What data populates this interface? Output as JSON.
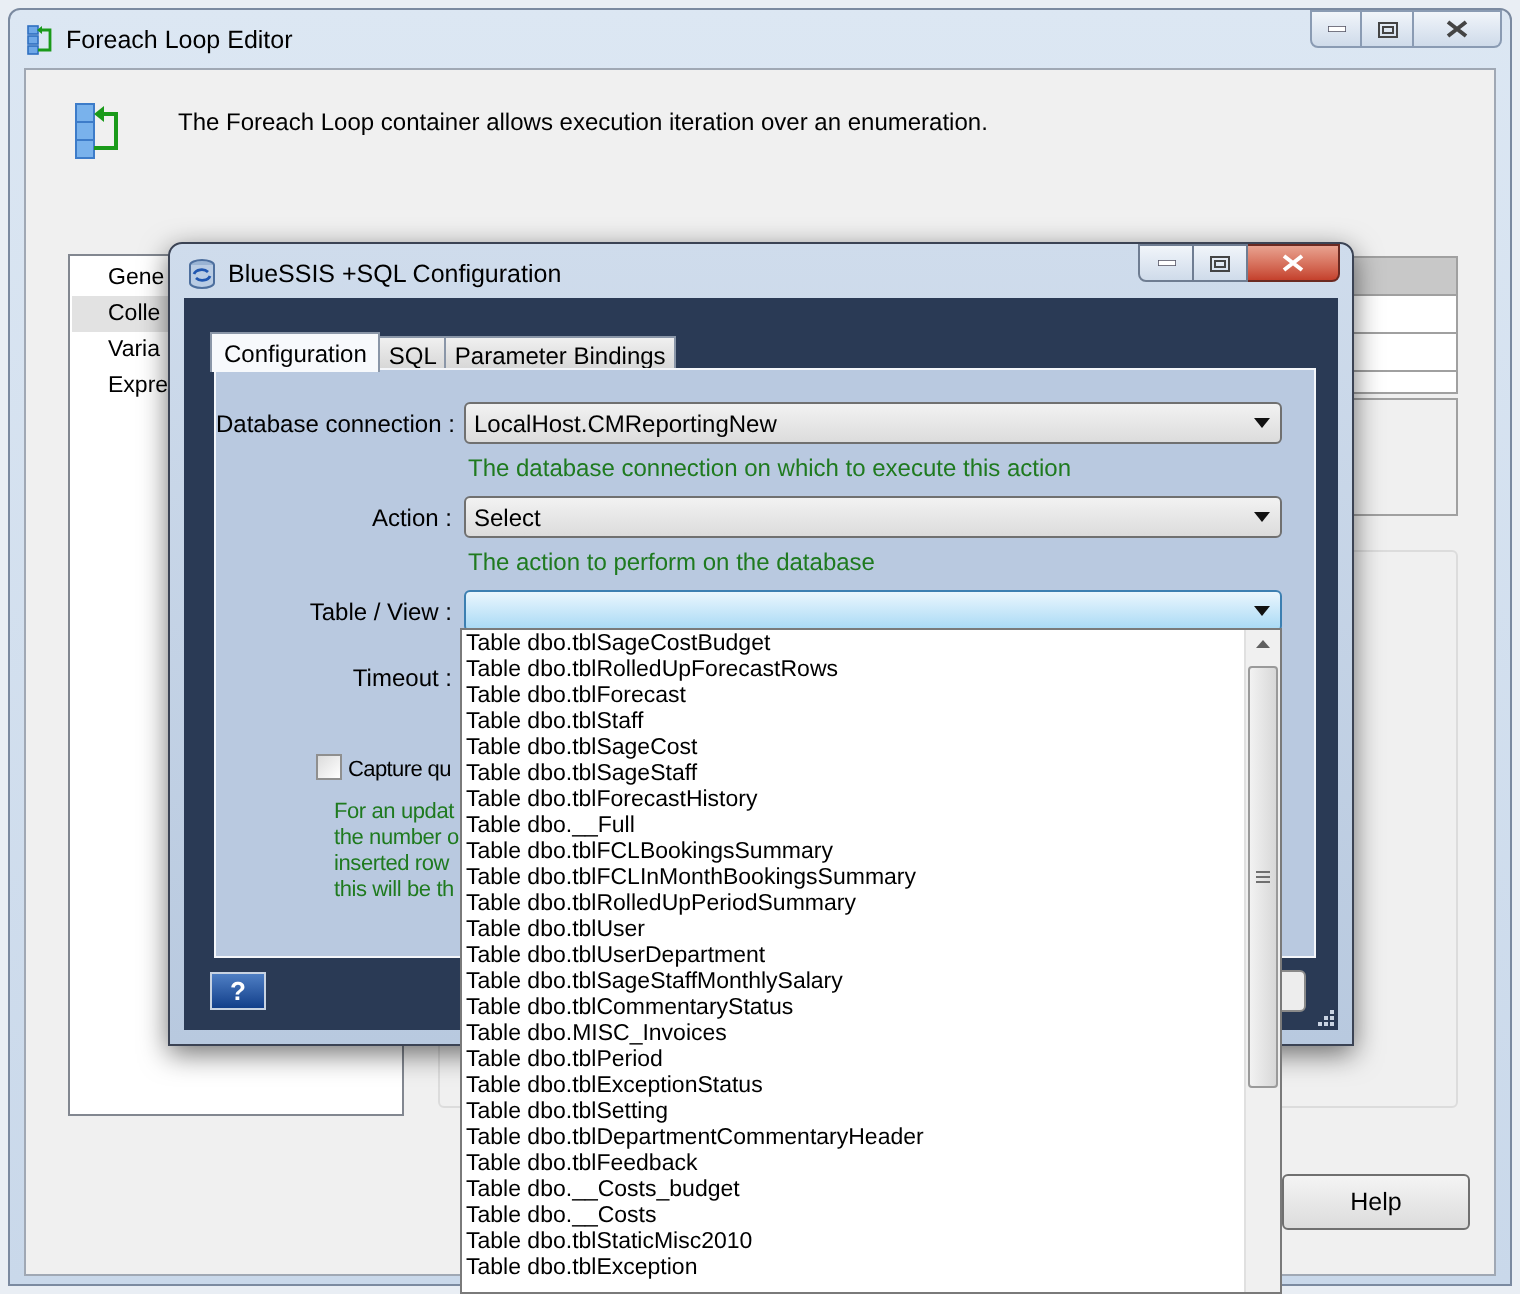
{
  "editor_window": {
    "title": "Foreach Loop Editor",
    "description": "The Foreach Loop container allows execution iteration over an enumeration.",
    "nav_items": [
      {
        "label": "Gene",
        "selected": false
      },
      {
        "label": "Colle",
        "selected": true
      },
      {
        "label": "Varia",
        "selected": false
      },
      {
        "label": "Expre",
        "selected": false
      }
    ],
    "help_button": "Help"
  },
  "config_dialog": {
    "title": "BlueSSIS +SQL Configuration",
    "tabs": [
      {
        "label": "Configuration",
        "selected": true
      },
      {
        "label": "SQL",
        "selected": false
      },
      {
        "label": "Parameter Bindings",
        "selected": false
      }
    ],
    "fields": [
      {
        "label": "Database connection :",
        "value": "LocalHost.CMReportingNew",
        "hint": "The database connection on which to execute this action",
        "focused": false
      },
      {
        "label": "Action :",
        "value": "Select",
        "hint": "The action to perform on the database",
        "focused": false
      },
      {
        "label": "Table / View :",
        "focused": true
      }
    ],
    "timeout_label": "Timeout :",
    "capture_checkbox": {
      "label": "Capture qu",
      "checked": false
    },
    "note_lines": [
      "For an updat",
      "the number o",
      "inserted row",
      "this will be th"
    ],
    "help_button": "?"
  },
  "dropdown": {
    "items": [
      "Table dbo.tblSageCostBudget",
      "Table dbo.tblRolledUpForecastRows",
      "Table dbo.tblForecast",
      "Table dbo.tblStaff",
      "Table dbo.tblSageCost",
      "Table dbo.tblSageStaff",
      "Table dbo.tblForecastHistory",
      "Table dbo.__Full",
      "Table dbo.tblFCLBookingsSummary",
      "Table dbo.tblFCLInMonthBookingsSummary",
      "Table dbo.tblRolledUpPeriodSummary",
      "Table dbo.tblUser",
      "Table dbo.tblUserDepartment",
      "Table dbo.tblSageStaffMonthlySalary",
      "Table dbo.tblCommentaryStatus",
      "Table dbo.MISC_Invoices",
      "Table dbo.tblPeriod",
      "Table dbo.tblExceptionStatus",
      "Table dbo.tblSetting",
      "Table dbo.tblDepartmentCommentaryHeader",
      "Table dbo.tblFeedback",
      "Table dbo.__Costs_budget",
      "Table dbo.__Costs",
      "Table dbo.tblStaticMisc2010",
      "Table dbo.tblException"
    ]
  }
}
